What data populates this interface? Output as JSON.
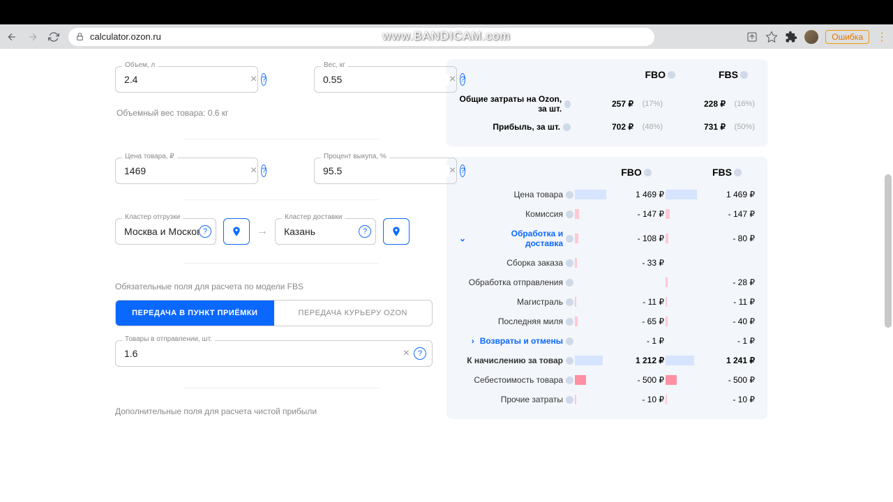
{
  "chrome": {
    "url": "calculator.ozon.ru",
    "error": "Ошибка"
  },
  "watermark": "www.BANDICAM.com",
  "fields": {
    "volume": {
      "label": "Объем, л",
      "value": "2.4"
    },
    "weight": {
      "label": "Вес, кг",
      "value": "0.55"
    },
    "price": {
      "label": "Цена товара, ₽",
      "value": "1469"
    },
    "buyout": {
      "label": "Процент выкупа, %",
      "value": "95.5"
    },
    "shipCluster": {
      "label": "Кластер отгрузки",
      "value": "Москва и Московск"
    },
    "deliverCluster": {
      "label": "Кластер доставки",
      "value": "Казань"
    },
    "itemsInShipment": {
      "label": "Товары в отправлении, шт.",
      "value": "1.6"
    }
  },
  "hints": {
    "volumetric": "Объемный вес товара: 0.6 кг",
    "fbsRequired": "Обязательные поля для расчета по модели FBS",
    "optional": "Дополнительные поля для расчета чистой прибыли"
  },
  "tabs": {
    "pickup": "ПЕРЕДАЧА В ПУНКТ ПРИЁМКИ",
    "courier": "ПЕРЕДАЧА КУРЬЕРУ OZON"
  },
  "summary": {
    "cols": [
      "FBO",
      "FBS"
    ],
    "rows": [
      {
        "label": "Общие затраты на Ozon, за шт.",
        "fbo": "257 ₽",
        "fboPct": "(17%)",
        "fbs": "228 ₽",
        "fbsPct": "(16%)"
      },
      {
        "label": "Прибыль, за шт.",
        "fbo": "702 ₽",
        "fboPct": "(48%)",
        "fbs": "731 ₽",
        "fbsPct": "(50%)"
      }
    ]
  },
  "table": {
    "cols": [
      "FBO",
      "FBS"
    ],
    "rows": [
      {
        "label": "Цена товара",
        "fbo": "1 469 ₽",
        "fbs": "1 469 ₽",
        "barType": "blue",
        "fboW": 45,
        "fbsW": 45
      },
      {
        "label": "Комиссия",
        "fbo": "- 147 ₽",
        "fbs": "- 147 ₽",
        "barType": "pink",
        "fboW": 6,
        "fbsW": 6
      },
      {
        "label": "Обработка и доставка",
        "fbo": "- 108 ₽",
        "fbs": "- 80 ₽",
        "barType": "pink",
        "fboW": 5,
        "fbsW": 4,
        "blue": true,
        "chev": "⌄"
      },
      {
        "label": "Сборка заказа",
        "fbo": "- 33 ₽",
        "fbs": "",
        "barType": "pink",
        "fboW": 3,
        "fbsW": 0
      },
      {
        "label": "Обработка отправления",
        "fbo": "",
        "fbs": "- 28 ₽",
        "barType": "pink",
        "fboW": 0,
        "fbsW": 3
      },
      {
        "label": "Магистраль",
        "fbo": "- 11 ₽",
        "fbs": "- 11 ₽",
        "barType": "pink",
        "fboW": 2,
        "fbsW": 2
      },
      {
        "label": "Последняя миля",
        "fbo": "- 65 ₽",
        "fbs": "- 40 ₽",
        "barType": "pink",
        "fboW": 4,
        "fbsW": 3
      },
      {
        "label": "Возвраты и отмены",
        "fbo": "- 1 ₽",
        "fbs": "- 1 ₽",
        "barType": "",
        "fboW": 0,
        "fbsW": 0,
        "blue": true,
        "chev": "›"
      },
      {
        "label": "К начислению за товар",
        "fbo": "1 212 ₽",
        "fbs": "1 241 ₽",
        "barType": "blue",
        "fboW": 40,
        "fbsW": 41,
        "bold": true
      },
      {
        "label": "Себестоимость товара",
        "fbo": "- 500 ₽",
        "fbs": "- 500 ₽",
        "barType": "red",
        "fboW": 16,
        "fbsW": 16
      },
      {
        "label": "Прочие затраты",
        "fbo": "- 10 ₽",
        "fbs": "- 10 ₽",
        "barType": "pink",
        "fboW": 2,
        "fbsW": 2
      }
    ]
  }
}
